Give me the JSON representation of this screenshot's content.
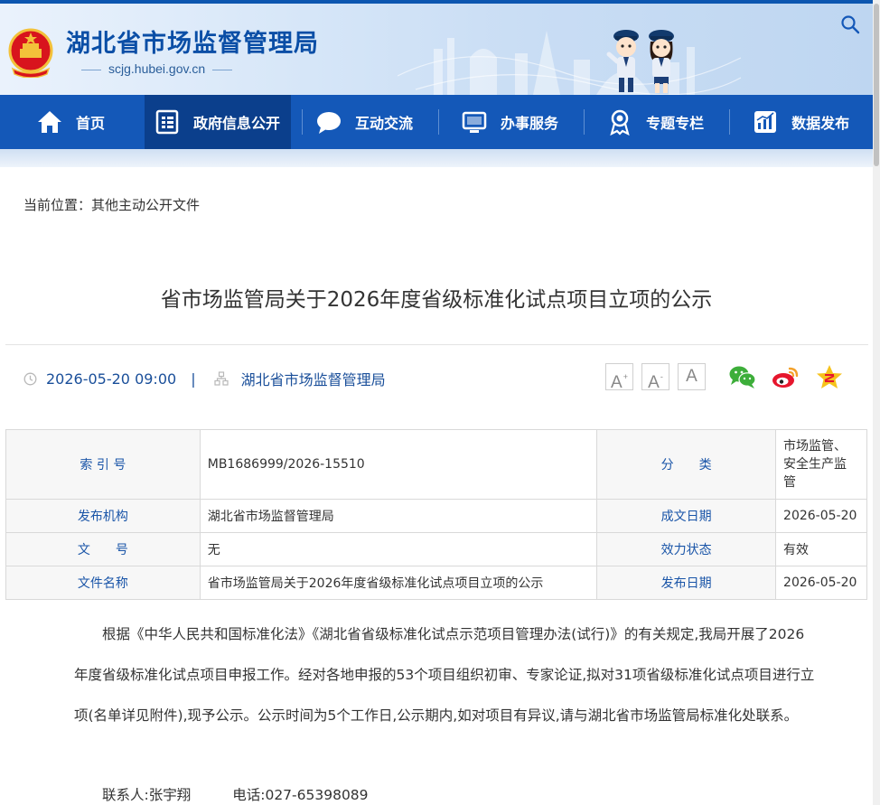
{
  "header": {
    "site_title": "湖北省市场监督管理局",
    "site_domain": "scjg.hubei.gov.cn"
  },
  "nav": {
    "items": [
      {
        "label": "首页",
        "icon": "home-icon"
      },
      {
        "label": "政府信息公开",
        "icon": "document-list-icon",
        "active": true
      },
      {
        "label": "互动交流",
        "icon": "chat-bubble-icon"
      },
      {
        "label": "办事服务",
        "icon": "monitor-icon"
      },
      {
        "label": "专题专栏",
        "icon": "award-icon"
      },
      {
        "label": "数据发布",
        "icon": "bar-chart-icon"
      }
    ]
  },
  "breadcrumb": {
    "prefix": "当前位置：",
    "current": "其他主动公开文件"
  },
  "article": {
    "title": "省市场监管局关于2026年度省级标准化试点项目立项的公示",
    "date": "2026-05-20 09:00",
    "pipe": "|",
    "org": "湖北省市场监督管理局"
  },
  "font_controls": {
    "larger": "A",
    "larger_sup": "+",
    "smaller": "A",
    "smaller_sup": "-",
    "default": "A"
  },
  "share": [
    "wechat-icon",
    "weibo-icon",
    "favorite-star-icon"
  ],
  "info_table": {
    "rows": [
      {
        "l1": "索 引 号",
        "v1": "MB1686999/2026-15510",
        "l2": "分　　类",
        "v2": "市场监管、安全生产监管"
      },
      {
        "l1": "发布机构",
        "v1": "湖北省市场监督管理局",
        "l2": "成文日期",
        "v2": "2026-05-20"
      },
      {
        "l1": "文　　号",
        "v1": "无",
        "l2": "效力状态",
        "v2": "有效"
      },
      {
        "l1": "文件名称",
        "v1": "省市场监管局关于2026年度省级标准化试点项目立项的公示",
        "l2": "发布日期",
        "v2": "2026-05-20"
      }
    ]
  },
  "body": {
    "paragraph": "根据《中华人民共和国标准化法》《湖北省省级标准化试点示范项目管理办法(试行)》的有关规定,我局开展了2026年度省级标准化试点项目申报工作。经对各地申报的53个项目组织初审、专家论证,拟对31项省级标准化试点项目进行立项(名单详见附件),现予公示。公示时间为5个工作日,公示期内,如对项目有异议,请与湖北省市场监管局标准化处联系。",
    "contact_name": "联系人:张宇翔",
    "contact_phone": "电话:027-65398089"
  },
  "colors": {
    "nav_bg": "#1458b8",
    "nav_active": "#0b3f8c",
    "title_blue": "#0a4ea6",
    "label_blue": "#1a55a8"
  }
}
